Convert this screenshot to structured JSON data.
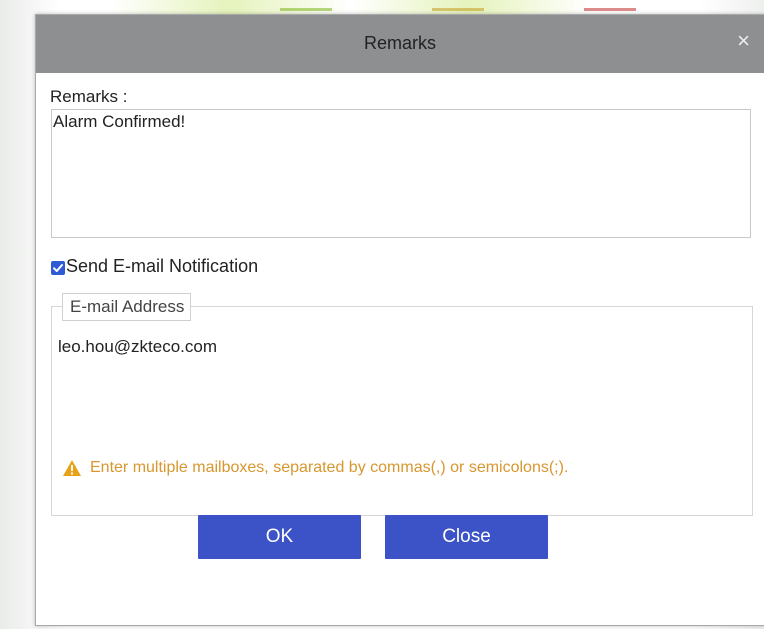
{
  "dialog": {
    "title": "Remarks",
    "close_glyph": "×",
    "remarks_label": "Remarks :",
    "remarks_value": "Alarm Confirmed!",
    "send_email": {
      "label": "Send E-mail Notification",
      "checked": true
    },
    "email": {
      "legend": "E-mail Address",
      "value": "leo.hou@zkteco.com",
      "hint_icon": "warning-icon",
      "hint": "Enter multiple mailboxes, separated by commas(,) or semicolons(;)."
    },
    "buttons": {
      "ok": "OK",
      "close": "Close"
    }
  },
  "colors": {
    "header_bg": "#8e8f91",
    "button_bg": "#3c52c7",
    "checkbox": "#2f5bd4",
    "hint_text": "#d9962e",
    "warning_icon": "#e8a21a"
  }
}
